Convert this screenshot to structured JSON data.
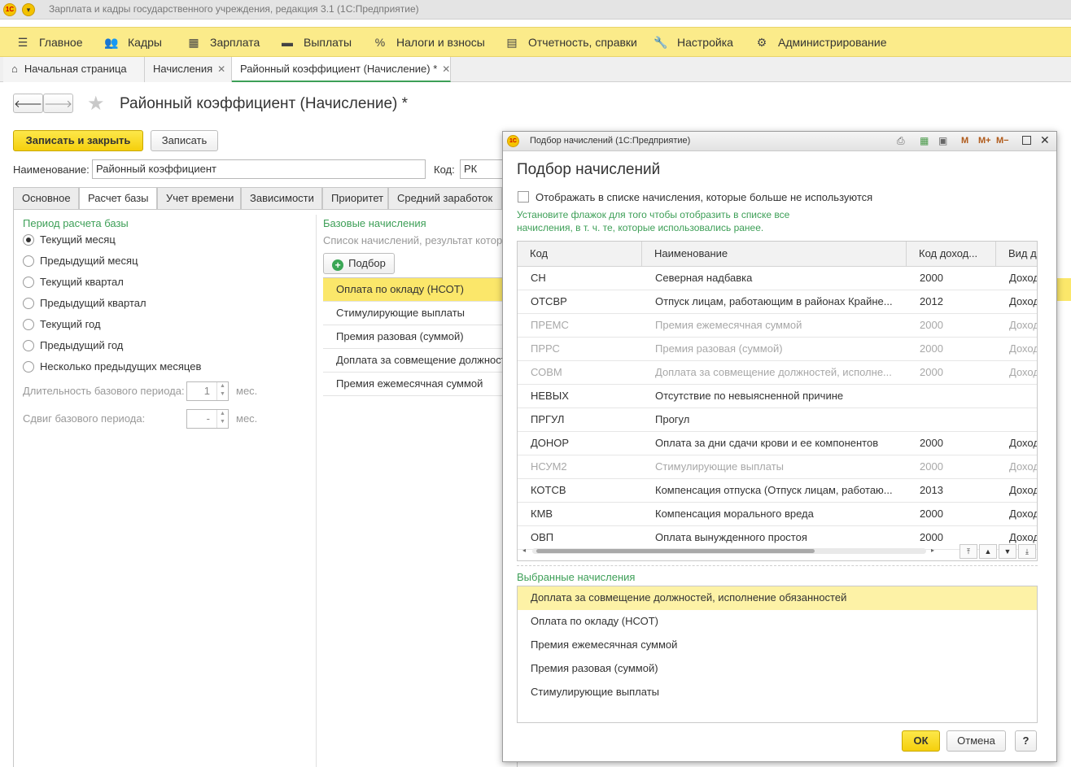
{
  "window": {
    "title": "Зарплата и кадры государственного учреждения, редакция 3.1  (1С:Предприятие)"
  },
  "menu": [
    {
      "label": "Главное",
      "icon": "hamburger-icon"
    },
    {
      "label": "Кадры",
      "icon": "people-icon"
    },
    {
      "label": "Зарплата",
      "icon": "calculator-icon"
    },
    {
      "label": "Выплаты",
      "icon": "wallet-icon"
    },
    {
      "label": "Налоги и взносы",
      "icon": "percent-icon"
    },
    {
      "label": "Отчетность, справки",
      "icon": "reports-icon"
    },
    {
      "label": "Настройка",
      "icon": "wrench-icon"
    },
    {
      "label": "Администрирование",
      "icon": "gear-icon"
    }
  ],
  "tabs": [
    {
      "label": "Начальная страница"
    },
    {
      "label": "Начисления"
    },
    {
      "label": "Районный коэффициент (Начисление) *"
    }
  ],
  "form": {
    "title": "Районный коэффициент (Начисление) *",
    "save_close": "Записать и закрыть",
    "save": "Записать",
    "name_label": "Наименование:",
    "name_value": "Районный коэффициент",
    "code_label": "Код:",
    "code_value": "РК",
    "tabs": [
      "Основное",
      "Расчет базы",
      "Учет времени",
      "Зависимости",
      "Приоритет",
      "Средний заработок"
    ],
    "period_title": "Период расчета базы",
    "periods": [
      "Текущий месяц",
      "Предыдущий месяц",
      "Текущий квартал",
      "Предыдущий квартал",
      "Текущий год",
      "Предыдущий год",
      "Несколько предыдущих месяцев"
    ],
    "duration_label": "Длительность базового периода:",
    "duration_value": "1",
    "shift_label": "Сдвиг базового периода:",
    "shift_value": "-",
    "unit": "мес.",
    "base_title": "Базовые начисления",
    "base_hint": "Список начислений, результат которы",
    "pick_button": "Подбор",
    "base_items": [
      "Оплата по окладу (НСОТ)",
      "Стимулирующие выплаты",
      "Премия разовая (суммой)",
      "Доплата за совмещение должност",
      "Премия ежемесячная суммой"
    ]
  },
  "dialog": {
    "window_title": "Подбор начислений  (1С:Предприятие)",
    "tool_labels": [
      "M",
      "M+",
      "M−"
    ],
    "heading": "Подбор начислений",
    "checkbox_label": "Отображать в списке начисления, которые больше не используются",
    "hint_line1": "Установите флажок для того чтобы отобразить в списке все",
    "hint_line2": "начисления, в т. ч. те, которые использовались ранее.",
    "columns": [
      "Код",
      "Наименование",
      "Код доход...",
      "Вид д"
    ],
    "rows": [
      {
        "code": "СН",
        "name": "Северная надбавка",
        "income": "2000",
        "kind": "Доход",
        "dim": false
      },
      {
        "code": "ОТСВР",
        "name": "Отпуск лицам, работающим в районах Крайне...",
        "income": "2012",
        "kind": "Доход",
        "dim": false
      },
      {
        "code": "ПРЕМС",
        "name": "Премия ежемесячная суммой",
        "income": "2000",
        "kind": "Доход",
        "dim": true
      },
      {
        "code": "ПРРС",
        "name": "Премия разовая (суммой)",
        "income": "2000",
        "kind": "Доход",
        "dim": true
      },
      {
        "code": "СОВМ",
        "name": "Доплата за совмещение должностей, исполне...",
        "income": "2000",
        "kind": "Доход",
        "dim": true
      },
      {
        "code": "НЕВЫХ",
        "name": "Отсутствие по невыясненной причине",
        "income": "",
        "kind": "",
        "dim": false
      },
      {
        "code": "ПРГУЛ",
        "name": "Прогул",
        "income": "",
        "kind": "",
        "dim": false
      },
      {
        "code": "ДОНОР",
        "name": "Оплата за дни сдачи крови и ее компонентов",
        "income": "2000",
        "kind": "Доход",
        "dim": false
      },
      {
        "code": "НСУМ2",
        "name": "Стимулирующие выплаты",
        "income": "2000",
        "kind": "Доход",
        "dim": true
      },
      {
        "code": "КОТСВ",
        "name": "Компенсация отпуска (Отпуск лицам, работаю...",
        "income": "2013",
        "kind": "Доход",
        "dim": false
      },
      {
        "code": "КМВ",
        "name": "Компенсация морального вреда",
        "income": "2000",
        "kind": "Доход",
        "dim": false
      },
      {
        "code": "ОВП",
        "name": "Оплата вынужденного простоя",
        "income": "2000",
        "kind": "Доход",
        "dim": false
      }
    ],
    "selected_title": "Выбранные начисления",
    "selected": [
      "Доплата за совмещение должностей, исполнение обязанностей",
      "Оплата по окладу (НСОТ)",
      "Премия ежемесячная суммой",
      "Премия разовая (суммой)",
      "Стимулирующие выплаты"
    ],
    "ok": "ОК",
    "cancel": "Отмена",
    "help": "?"
  }
}
